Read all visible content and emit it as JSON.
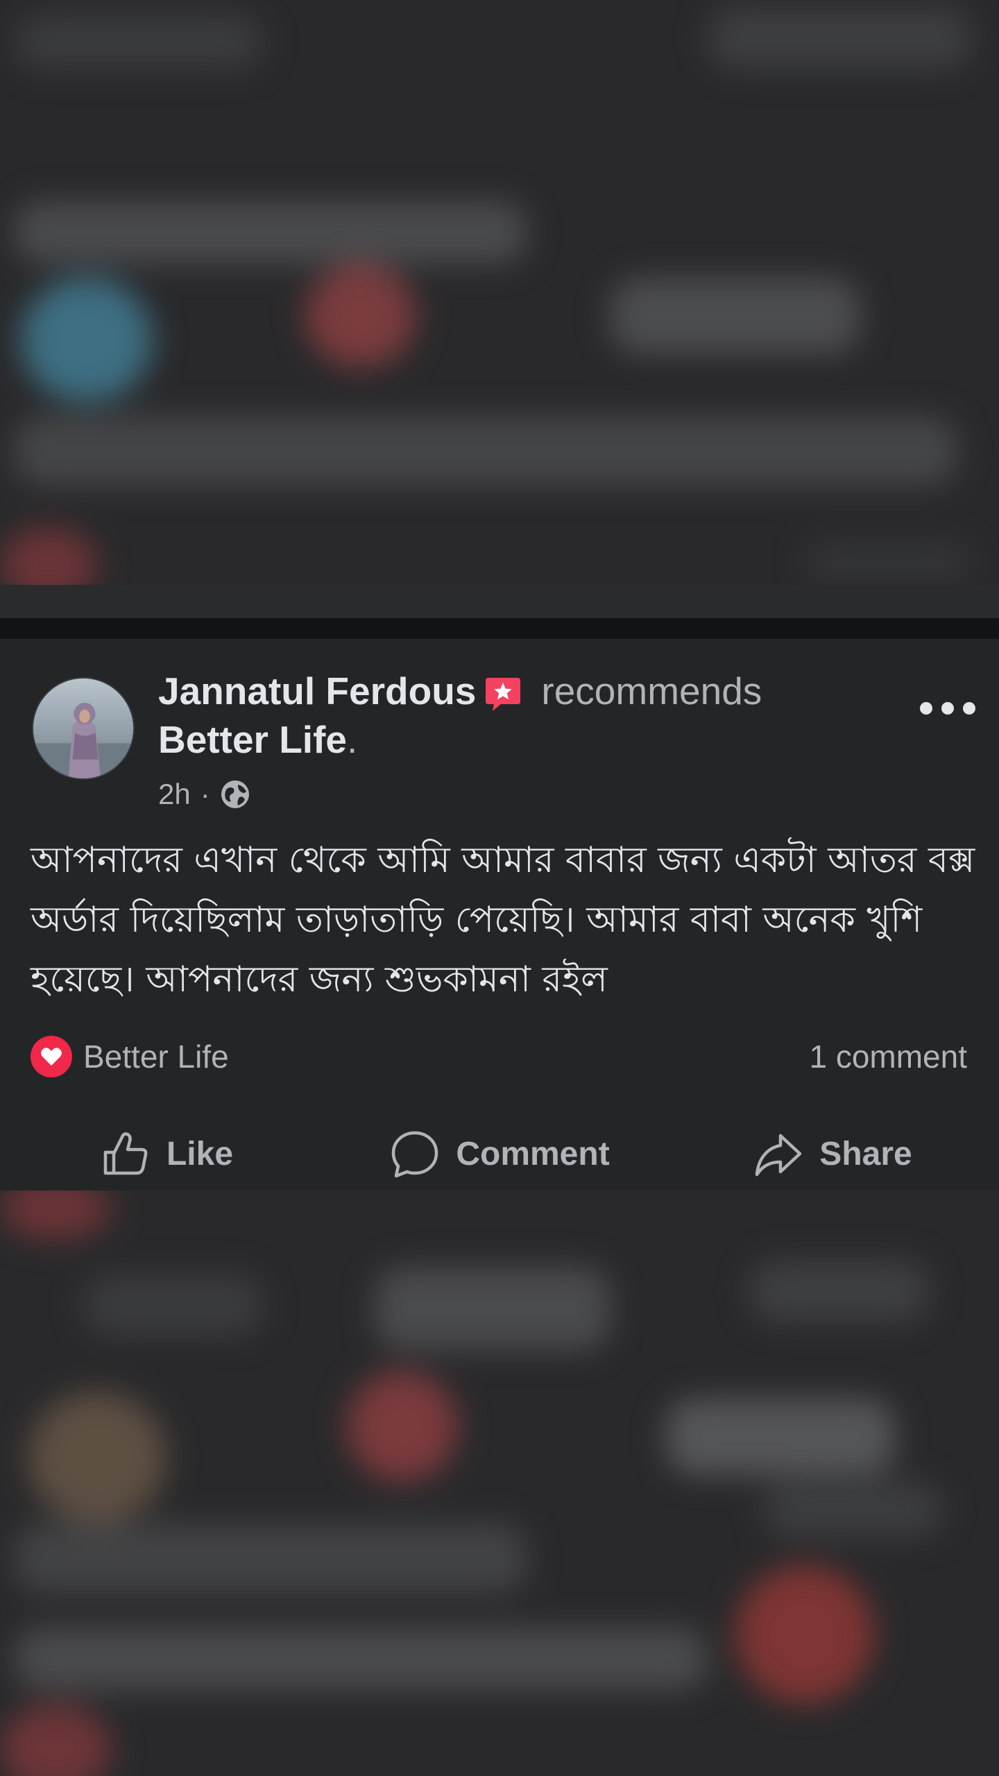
{
  "post": {
    "author": "Jannatul Ferdous",
    "author_badge_icon": "star-badge-icon",
    "action_text": "recommends",
    "page_name": "Better Life",
    "page_name_suffix": ".",
    "time": "2h",
    "time_separator": "·",
    "privacy_icon": "globe-icon",
    "more_icon": "more-options-icon",
    "text": "আপনাদের এখান থেকে আমি আমার বাবার জন্য একটা আতর বক্স অর্ডার দিয়েছিলাম তাড়াতাড়ি পেয়েছি। আমার বাবা অনেক খুশি হয়েছে। আপনাদের জন্য শুভকামনা রইল",
    "reaction": {
      "icon": "heart-icon",
      "name": "Better Life"
    },
    "comments_count": "1 comment",
    "actions": {
      "like": "Like",
      "comment": "Comment",
      "share": "Share"
    }
  },
  "colors": {
    "background": "#242527",
    "primary_text": "#e4e6eb",
    "secondary_text": "#b0b3b8",
    "heart_badge": "#f02849",
    "star_badge": "#f3425f"
  }
}
